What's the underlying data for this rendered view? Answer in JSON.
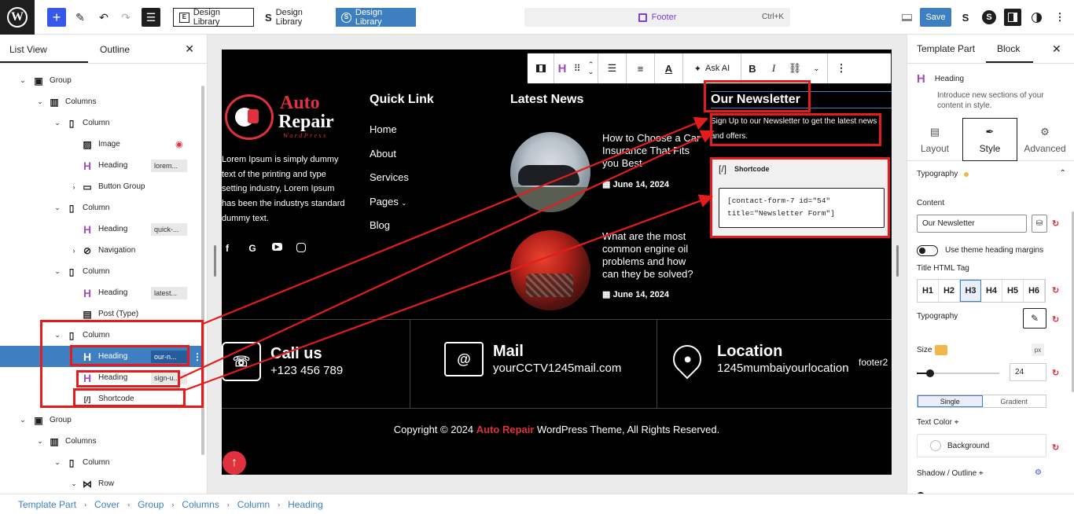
{
  "topbar": {
    "design_library_1": "Design Library",
    "design_library_2": "Design Library",
    "design_library_3": "Design Library",
    "command_title": "Footer",
    "command_shortcut": "Ctrl+K",
    "save_label": "Save"
  },
  "left_panel": {
    "tab_list_view": "List View",
    "tab_outline": "Outline",
    "tree": [
      {
        "label": "Group",
        "indent": 0,
        "chev": "v",
        "icon": "group"
      },
      {
        "label": "Columns",
        "indent": 1,
        "chev": "v",
        "icon": "columns"
      },
      {
        "label": "Column",
        "indent": 2,
        "chev": "v",
        "icon": "column"
      },
      {
        "label": "Image",
        "indent": 3,
        "chev": "",
        "icon": "image"
      },
      {
        "label": "Heading",
        "indent": 3,
        "chev": "",
        "icon": "heading",
        "badge": "lorem..."
      },
      {
        "label": "Button Group",
        "indent": 3,
        "chev": ">",
        "icon": "button-group"
      },
      {
        "label": "Column",
        "indent": 2,
        "chev": "v",
        "icon": "column"
      },
      {
        "label": "Heading",
        "indent": 3,
        "chev": "",
        "icon": "heading",
        "badge": "quick-..."
      },
      {
        "label": "Navigation",
        "indent": 3,
        "chev": ">",
        "icon": "navigation"
      },
      {
        "label": "Column",
        "indent": 2,
        "chev": "v",
        "icon": "column"
      },
      {
        "label": "Heading",
        "indent": 3,
        "chev": "",
        "icon": "heading",
        "badge": "latest..."
      },
      {
        "label": "Post (Type)",
        "indent": 3,
        "chev": "",
        "icon": "post-type"
      },
      {
        "label": "Column",
        "indent": 2,
        "chev": "v",
        "icon": "column"
      },
      {
        "label": "Heading",
        "indent": 3,
        "chev": "",
        "icon": "heading",
        "badge": "our-n...",
        "selected": true
      },
      {
        "label": "Heading",
        "indent": 3,
        "chev": "",
        "icon": "heading",
        "badge": "sign-u..."
      },
      {
        "label": "Shortcode",
        "indent": 3,
        "chev": "",
        "icon": "shortcode"
      },
      {
        "label": "Group",
        "indent": 0,
        "chev": "v",
        "icon": "group"
      },
      {
        "label": "Columns",
        "indent": 1,
        "chev": "v",
        "icon": "columns"
      },
      {
        "label": "Column",
        "indent": 2,
        "chev": "v",
        "icon": "column"
      },
      {
        "label": "Row",
        "indent": 3,
        "chev": "v",
        "icon": "row"
      }
    ]
  },
  "toolbar": {
    "ask_ai": "Ask AI"
  },
  "canvas": {
    "logo_auto": "Auto",
    "logo_repair": "Repair",
    "logo_sub": "WordPress",
    "about_text": "Lorem Ipsum is simply dummy text of the printing and type setting industry, Lorem Ipsum has been the industrys standard dummy text.",
    "quick_link_title": "Quick Link",
    "quick_links": [
      "Home",
      "About",
      "Services",
      "Pages",
      "Blog"
    ],
    "latest_news_title": "Latest News",
    "news": [
      {
        "title": "How to Choose a Car Insurance That Fits you Best",
        "date": "June 14, 2024"
      },
      {
        "title": "What are the most common engine oil problems and how can they be solved?",
        "date": "June 14, 2024"
      }
    ],
    "newsletter_title": "Our Newsletter",
    "newsletter_sub": "Sign Up to our Newsletter to get the latest news and offers.",
    "shortcode_label": "Shortcode",
    "shortcode_value": "[contact-form-7 id=\"54\"\ntitle=\"Newsletter Form\"]",
    "contacts": [
      {
        "title": "Call us",
        "value": "+123 456 789"
      },
      {
        "title": "Mail",
        "value": "yourCCTV1245mail.com"
      },
      {
        "title": "Location",
        "value": "1245mumbaiyourlocation"
      }
    ],
    "footer2": "footer2",
    "copyright_pre": "Copyright © 2024 ",
    "copyright_brand": "Auto Repair",
    "copyright_post": " WordPress Theme, All Rights Reserved."
  },
  "right_panel": {
    "tab_template_part": "Template Part",
    "tab_block": "Block",
    "block_name": "Heading",
    "block_desc": "Introduce new sections of your content in style.",
    "subtab_layout": "Layout",
    "subtab_style": "Style",
    "subtab_advanced": "Advanced",
    "typography_section": "Typography",
    "content_label": "Content",
    "content_value": "Our Newsletter",
    "theme_margins_label": "Use theme heading margins",
    "title_tag_label": "Title HTML Tag",
    "tags": [
      "H1",
      "H2",
      "H3",
      "H4",
      "H5",
      "H6"
    ],
    "active_tag": "H3",
    "typography_label": "Typography",
    "size_label": "Size",
    "size_unit": "px",
    "size_value": "24",
    "seg_single": "Single",
    "seg_gradient": "Gradient",
    "text_color_label": "Text Color",
    "background_label": "Background",
    "shadow_label": "Shadow / Outline"
  },
  "breadcrumb": [
    "Template Part",
    "Cover",
    "Group",
    "Columns",
    "Column",
    "Heading"
  ]
}
